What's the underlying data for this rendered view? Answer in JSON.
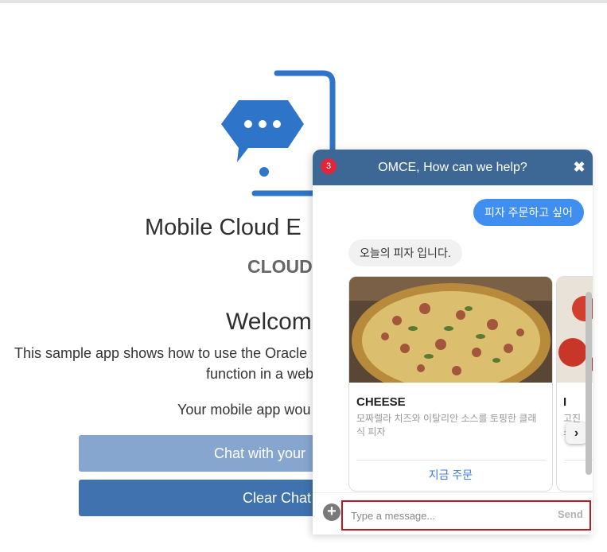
{
  "page": {
    "title_partial": "Mobile Cloud E",
    "subtitle_partial": "CLOUD",
    "welcome_partial": "Welcom",
    "desc_line1": "This sample app shows how to use the Oracle",
    "desc_line2": "function in a web",
    "desc_line3": "Your mobile app wou",
    "chat_button": "Chat with your",
    "clear_button": "Clear Chat"
  },
  "chat": {
    "title": "OMCE, How can we help?",
    "unread_count": "3",
    "close_icon": "close-icon",
    "messages": [
      {
        "from": "user",
        "text": "피자 주문하고 싶어"
      },
      {
        "from": "bot",
        "text": "오늘의 피자 입니다."
      }
    ],
    "cards": [
      {
        "title": "CHEESE",
        "description": "모짜렐라 치즈와 이탈리안 소스를 토핑한 클래식 피자",
        "action": "지금 주문"
      },
      {
        "title": "I",
        "description": "고진\n스를",
        "action": ""
      }
    ],
    "input_placeholder": "Type a message...",
    "send_label": "Send"
  },
  "colors": {
    "header": "#3d6896",
    "user_bubble": "#3f8ef0",
    "badge": "#e0263a",
    "input_highlight": "#c4161c",
    "logo_blue": "#2e74c9"
  }
}
